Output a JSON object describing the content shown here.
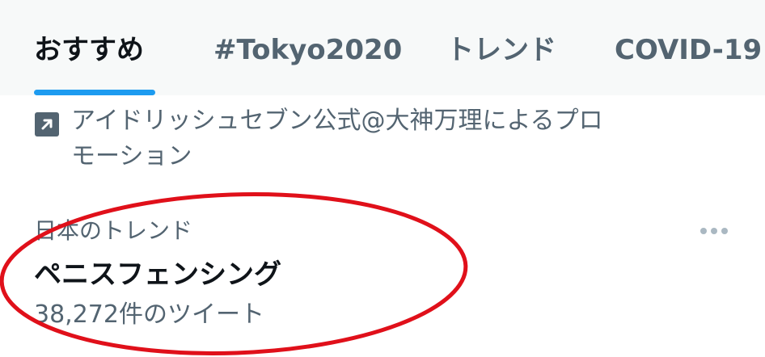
{
  "tabs": [
    {
      "label": "おすすめ",
      "active": true
    },
    {
      "label": "#Tokyo2020",
      "active": false
    },
    {
      "label": "トレンド",
      "active": false
    },
    {
      "label": "COVID-19",
      "active": false
    }
  ],
  "promo": {
    "icon": "promoted-arrow-icon",
    "text": "アイドリッシュセブン公式@大神万理によるプロモーション"
  },
  "trend": {
    "context": "日本のトレンド",
    "name": "ペニスフェンシング",
    "count": "38,272件のツイート",
    "more_icon": "more-dots-icon"
  },
  "colors": {
    "accent": "#1d9bf0",
    "annotation": "#e0101a",
    "secondary_text": "#536471",
    "primary_text": "#0f1419"
  }
}
